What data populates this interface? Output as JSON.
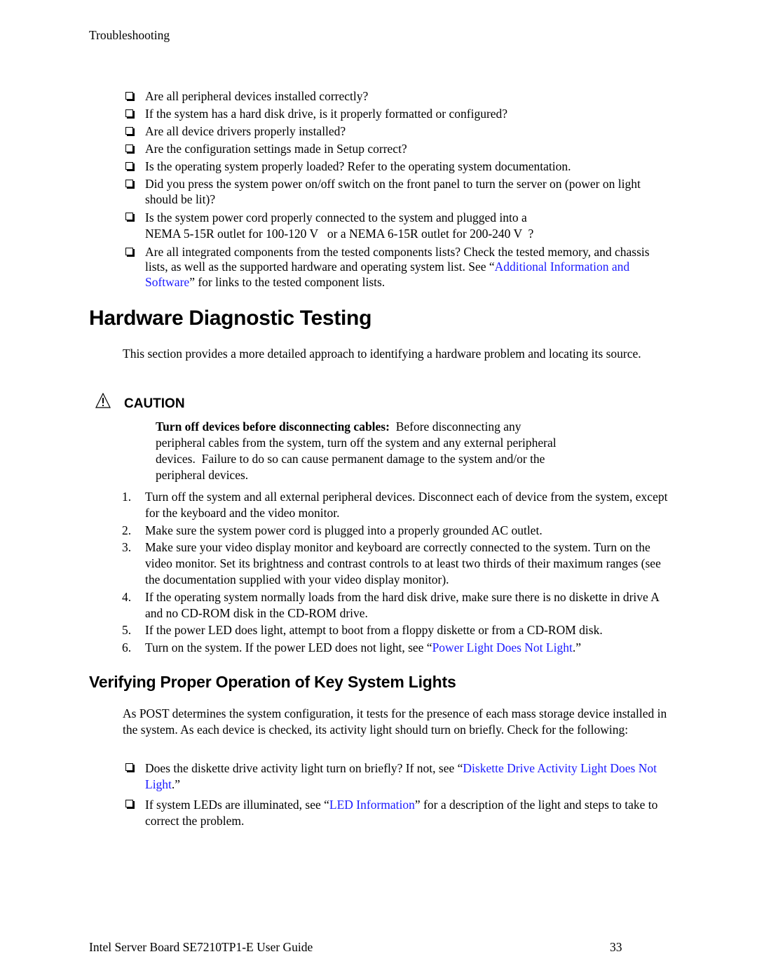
{
  "header": {
    "section": "Troubleshooting"
  },
  "checklist_top": [
    {
      "text": "Are all peripheral devices installed correctly?"
    },
    {
      "text": "If the system has a hard disk drive, is it properly formatted or configured?"
    },
    {
      "text": "Are all device drivers properly installed?"
    },
    {
      "text": "Are the configuration settings made in Setup correct?"
    },
    {
      "text": "Is the operating system properly loaded?  Refer to the operating system documentation."
    },
    {
      "text": "Did you press the system power on/off switch on the front panel to turn the server on (power on light should be lit)?"
    },
    {
      "line1": "Is the system power cord properly connected to the system and plugged into a",
      "line2": "NEMA 5-15R outlet for 100-120 V   or a NEMA 6-15R outlet for 200-240 V  ?"
    },
    {
      "before": "Are all integrated components from the tested components lists? Check the tested memory, and chassis lists, as well as the supported hardware and operating system list. See “",
      "link": "Additional Information and Software",
      "after": "” for links to the tested component lists."
    }
  ],
  "section1": {
    "title": "Hardware Diagnostic Testing",
    "intro": "This section provides a more detailed approach to identifying a hardware problem and locating its source."
  },
  "caution": {
    "icon": "warning-triangle-icon",
    "title": "CAUTION",
    "bold_lead": "Turn off devices before disconnecting cables:",
    "body": "  Before disconnecting any peripheral cables from the system, turn off the system and any external peripheral devices.  Failure to do so can cause permanent damage to the system and/or the peripheral devices."
  },
  "steps": [
    {
      "num": "1.",
      "text": "Turn off the system and all external peripheral devices.  Disconnect each of device from the system, except for the keyboard and the video monitor."
    },
    {
      "num": "2.",
      "text": "Make sure the system power cord is plugged into a properly grounded AC outlet."
    },
    {
      "num": "3.",
      "text": "Make sure your video display monitor and keyboard are correctly connected to the system.  Turn on the video monitor.  Set its brightness and contrast controls to at least two thirds of their maximum ranges (see the documentation supplied with your video display monitor)."
    },
    {
      "num": "4.",
      "text": "If the operating system normally loads from the hard disk drive, make sure there is no diskette in drive A and no CD-ROM disk in the CD-ROM drive."
    },
    {
      "num": "5.",
      "text": "If the power LED does light, attempt to boot from a floppy diskette or from a CD-ROM disk."
    },
    {
      "num": "6.",
      "before": "Turn on the system.  If the power LED does not light, see “",
      "link": "Power Light Does Not Light",
      "after": ".”"
    }
  ],
  "section2": {
    "title": "Verifying Proper Operation of Key System Lights",
    "intro": "As POST determines the system configuration, it tests for the presence of each mass storage device installed in the system.  As each device is checked, its activity light should turn on briefly.  Check for the following:"
  },
  "checklist_bottom": [
    {
      "before": "Does the diskette drive activity light turn on briefly?  If not, see “",
      "link": "Diskette Drive Activity Light Does Not Light",
      "after": ".”"
    },
    {
      "before": "If system LEDs are illuminated, see “",
      "link": "LED Information",
      "after": "” for a description of the light and steps to take to correct the problem."
    }
  ],
  "footer": {
    "title": "Intel Server Board SE7210TP1-E User Guide",
    "page": "33"
  },
  "colors": {
    "link": "#1a1aff",
    "text": "#000000"
  }
}
